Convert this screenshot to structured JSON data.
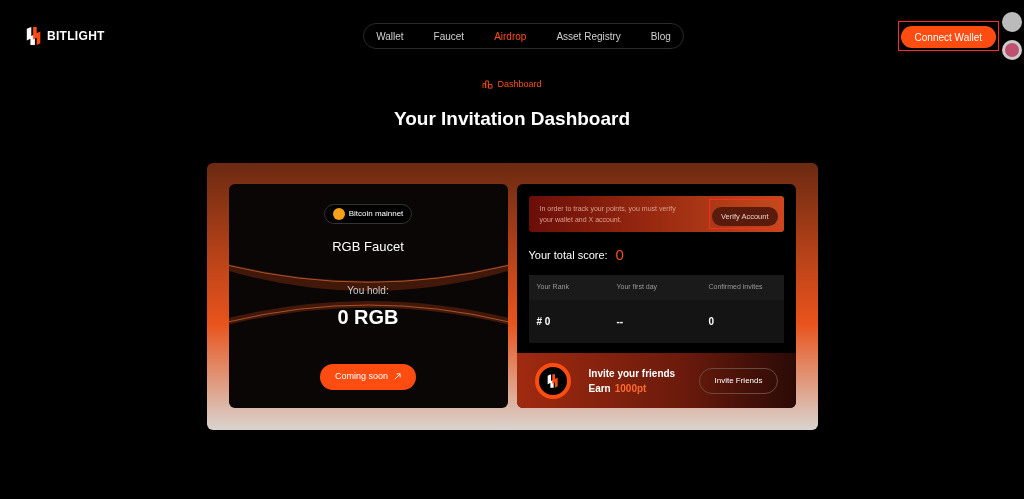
{
  "header": {
    "logo": "BITLIGHT",
    "nav": [
      {
        "label": "Wallet",
        "selected": false
      },
      {
        "label": "Faucet",
        "selected": false
      },
      {
        "label": "Airdrop",
        "selected": true
      },
      {
        "label": "Asset Registry",
        "selected": false
      },
      {
        "label": "Blog",
        "selected": false
      }
    ],
    "connect_button": "Connect Wallet"
  },
  "page": {
    "breadcrumb": "Dashboard",
    "title": "Your Invitation Dashboard"
  },
  "faucet_card": {
    "network": "Bitcoin mainnet",
    "title": "RGB Faucet",
    "hold_label": "You hold:",
    "amount": "0 RGB",
    "button": "Coming soon"
  },
  "score_card": {
    "notice": "In order to track your points, you must verify your wallet and X account.",
    "verify_button": "Verify Account",
    "score_label": "Your total score:",
    "score": "0",
    "stats": [
      {
        "label": "Your Rank",
        "value": "# 0"
      },
      {
        "label": "Your first day",
        "value": "--"
      },
      {
        "label": "Confirmed invites",
        "value": "0"
      }
    ],
    "invite": {
      "title": "Invite your friends",
      "earn_label": "Earn",
      "earn_amount": "1000pt",
      "button": "Invite Friends"
    }
  }
}
